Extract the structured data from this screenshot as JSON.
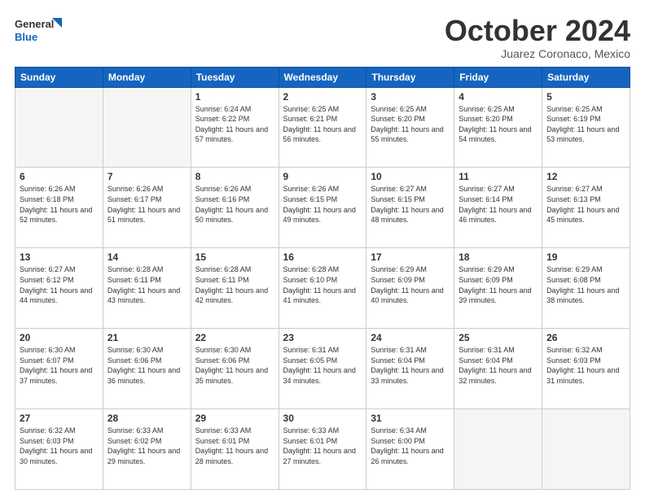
{
  "header": {
    "logo_line1": "General",
    "logo_line2": "Blue",
    "month": "October 2024",
    "location": "Juarez Coronaco, Mexico"
  },
  "weekdays": [
    "Sunday",
    "Monday",
    "Tuesday",
    "Wednesday",
    "Thursday",
    "Friday",
    "Saturday"
  ],
  "weeks": [
    [
      {
        "day": "",
        "text": ""
      },
      {
        "day": "",
        "text": ""
      },
      {
        "day": "1",
        "text": "Sunrise: 6:24 AM\nSunset: 6:22 PM\nDaylight: 11 hours and 57 minutes."
      },
      {
        "day": "2",
        "text": "Sunrise: 6:25 AM\nSunset: 6:21 PM\nDaylight: 11 hours and 56 minutes."
      },
      {
        "day": "3",
        "text": "Sunrise: 6:25 AM\nSunset: 6:20 PM\nDaylight: 11 hours and 55 minutes."
      },
      {
        "day": "4",
        "text": "Sunrise: 6:25 AM\nSunset: 6:20 PM\nDaylight: 11 hours and 54 minutes."
      },
      {
        "day": "5",
        "text": "Sunrise: 6:25 AM\nSunset: 6:19 PM\nDaylight: 11 hours and 53 minutes."
      }
    ],
    [
      {
        "day": "6",
        "text": "Sunrise: 6:26 AM\nSunset: 6:18 PM\nDaylight: 11 hours and 52 minutes."
      },
      {
        "day": "7",
        "text": "Sunrise: 6:26 AM\nSunset: 6:17 PM\nDaylight: 11 hours and 51 minutes."
      },
      {
        "day": "8",
        "text": "Sunrise: 6:26 AM\nSunset: 6:16 PM\nDaylight: 11 hours and 50 minutes."
      },
      {
        "day": "9",
        "text": "Sunrise: 6:26 AM\nSunset: 6:15 PM\nDaylight: 11 hours and 49 minutes."
      },
      {
        "day": "10",
        "text": "Sunrise: 6:27 AM\nSunset: 6:15 PM\nDaylight: 11 hours and 48 minutes."
      },
      {
        "day": "11",
        "text": "Sunrise: 6:27 AM\nSunset: 6:14 PM\nDaylight: 11 hours and 46 minutes."
      },
      {
        "day": "12",
        "text": "Sunrise: 6:27 AM\nSunset: 6:13 PM\nDaylight: 11 hours and 45 minutes."
      }
    ],
    [
      {
        "day": "13",
        "text": "Sunrise: 6:27 AM\nSunset: 6:12 PM\nDaylight: 11 hours and 44 minutes."
      },
      {
        "day": "14",
        "text": "Sunrise: 6:28 AM\nSunset: 6:11 PM\nDaylight: 11 hours and 43 minutes."
      },
      {
        "day": "15",
        "text": "Sunrise: 6:28 AM\nSunset: 6:11 PM\nDaylight: 11 hours and 42 minutes."
      },
      {
        "day": "16",
        "text": "Sunrise: 6:28 AM\nSunset: 6:10 PM\nDaylight: 11 hours and 41 minutes."
      },
      {
        "day": "17",
        "text": "Sunrise: 6:29 AM\nSunset: 6:09 PM\nDaylight: 11 hours and 40 minutes."
      },
      {
        "day": "18",
        "text": "Sunrise: 6:29 AM\nSunset: 6:09 PM\nDaylight: 11 hours and 39 minutes."
      },
      {
        "day": "19",
        "text": "Sunrise: 6:29 AM\nSunset: 6:08 PM\nDaylight: 11 hours and 38 minutes."
      }
    ],
    [
      {
        "day": "20",
        "text": "Sunrise: 6:30 AM\nSunset: 6:07 PM\nDaylight: 11 hours and 37 minutes."
      },
      {
        "day": "21",
        "text": "Sunrise: 6:30 AM\nSunset: 6:06 PM\nDaylight: 11 hours and 36 minutes."
      },
      {
        "day": "22",
        "text": "Sunrise: 6:30 AM\nSunset: 6:06 PM\nDaylight: 11 hours and 35 minutes."
      },
      {
        "day": "23",
        "text": "Sunrise: 6:31 AM\nSunset: 6:05 PM\nDaylight: 11 hours and 34 minutes."
      },
      {
        "day": "24",
        "text": "Sunrise: 6:31 AM\nSunset: 6:04 PM\nDaylight: 11 hours and 33 minutes."
      },
      {
        "day": "25",
        "text": "Sunrise: 6:31 AM\nSunset: 6:04 PM\nDaylight: 11 hours and 32 minutes."
      },
      {
        "day": "26",
        "text": "Sunrise: 6:32 AM\nSunset: 6:03 PM\nDaylight: 11 hours and 31 minutes."
      }
    ],
    [
      {
        "day": "27",
        "text": "Sunrise: 6:32 AM\nSunset: 6:03 PM\nDaylight: 11 hours and 30 minutes."
      },
      {
        "day": "28",
        "text": "Sunrise: 6:33 AM\nSunset: 6:02 PM\nDaylight: 11 hours and 29 minutes."
      },
      {
        "day": "29",
        "text": "Sunrise: 6:33 AM\nSunset: 6:01 PM\nDaylight: 11 hours and 28 minutes."
      },
      {
        "day": "30",
        "text": "Sunrise: 6:33 AM\nSunset: 6:01 PM\nDaylight: 11 hours and 27 minutes."
      },
      {
        "day": "31",
        "text": "Sunrise: 6:34 AM\nSunset: 6:00 PM\nDaylight: 11 hours and 26 minutes."
      },
      {
        "day": "",
        "text": ""
      },
      {
        "day": "",
        "text": ""
      }
    ]
  ]
}
